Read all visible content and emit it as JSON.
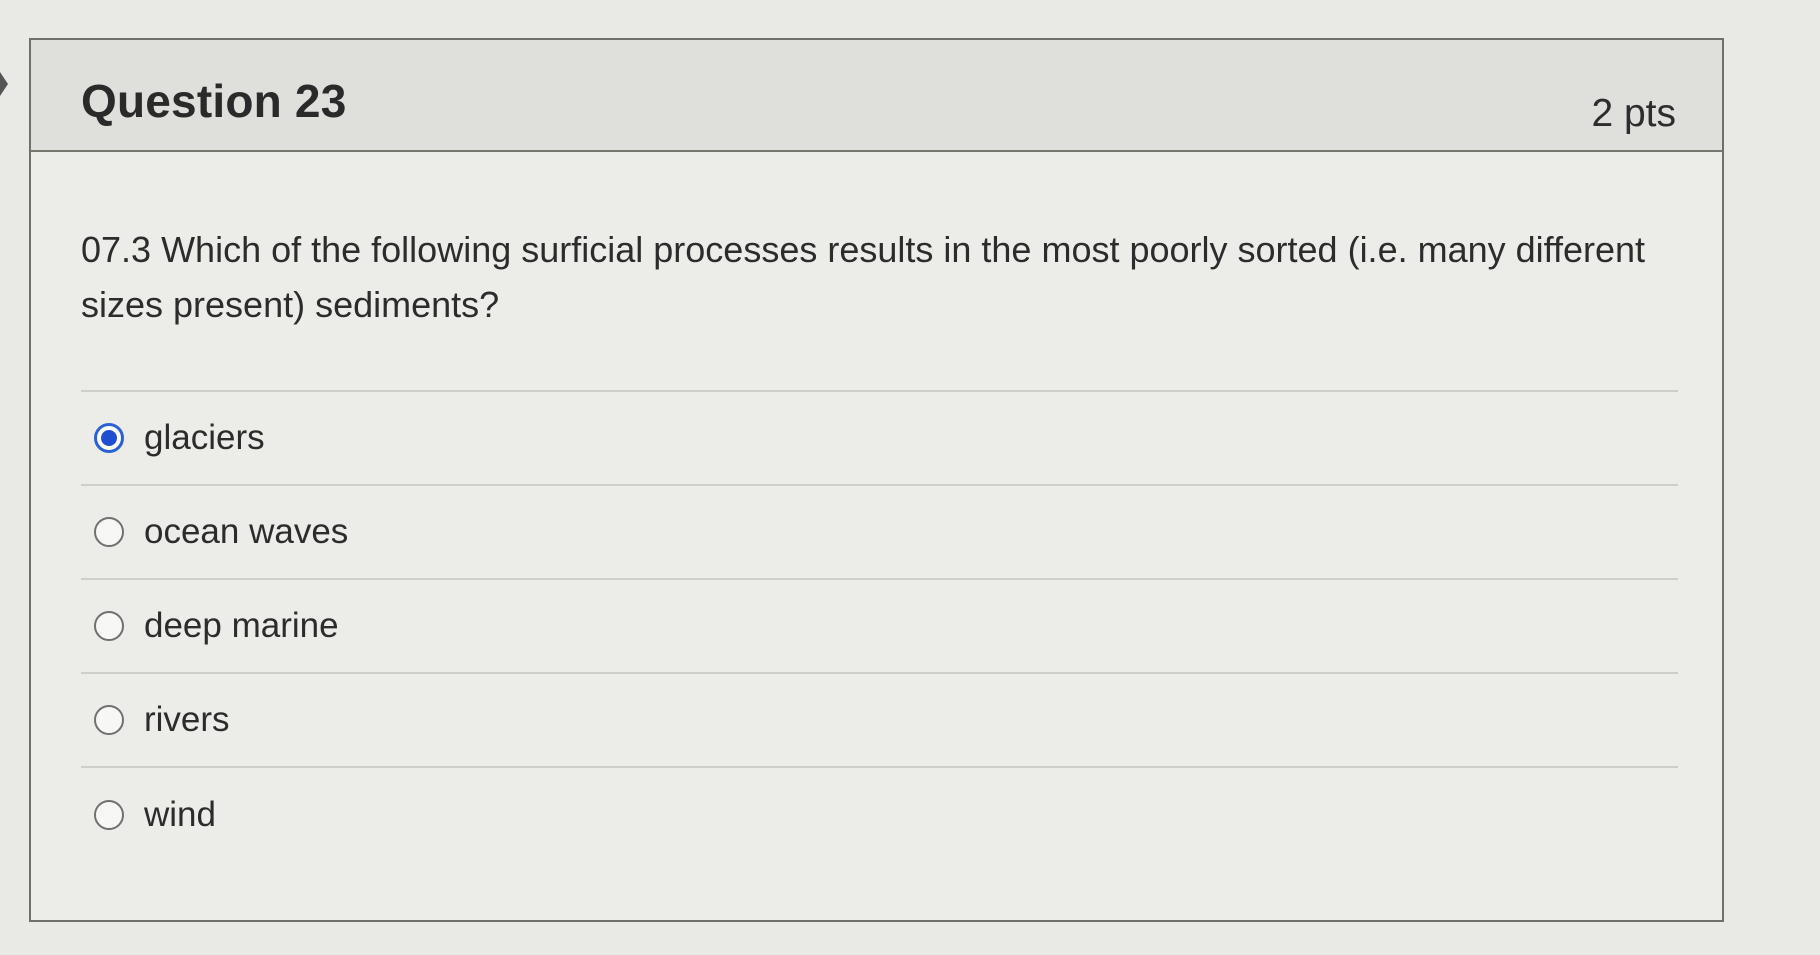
{
  "question": {
    "title": "Question 23",
    "points": "2 pts",
    "text": "07.3 Which of the following surficial processes results in the most poorly sorted (i.e. many different sizes present) sediments?"
  },
  "answers": [
    {
      "label": "glaciers",
      "selected": true
    },
    {
      "label": "ocean waves",
      "selected": false
    },
    {
      "label": "deep marine",
      "selected": false
    },
    {
      "label": "rivers",
      "selected": false
    },
    {
      "label": "wind",
      "selected": false
    }
  ],
  "colors": {
    "selected_radio": "#1f4fd1",
    "header_bg": "#dfdfdc",
    "card_border": "#6f6f6c"
  },
  "icons": {
    "edge": "chevron-right-icon",
    "selected": "radio-selected-icon",
    "unselected": "radio-unselected-icon"
  }
}
